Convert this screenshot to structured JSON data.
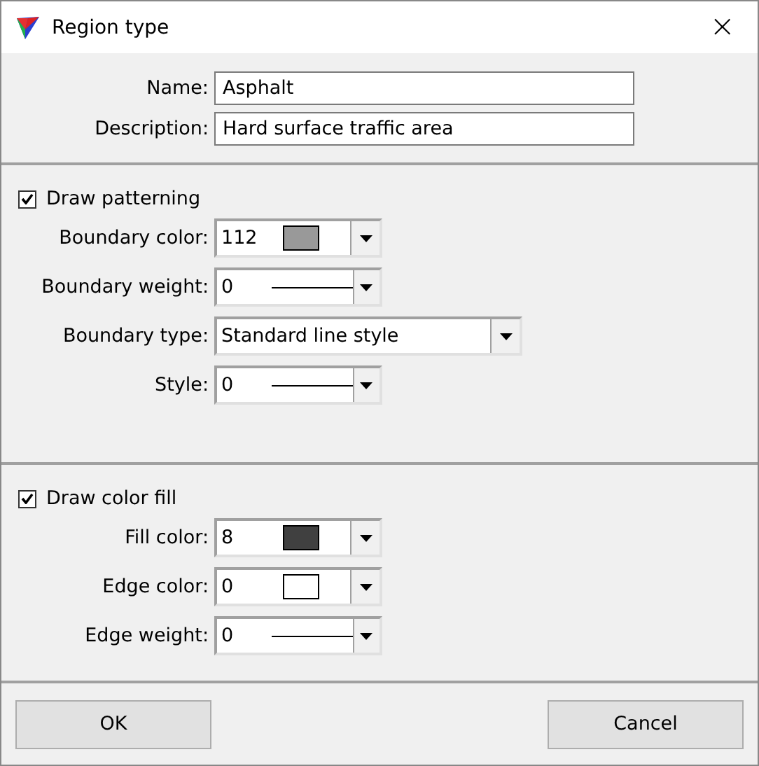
{
  "window": {
    "title": "Region type",
    "close": "×"
  },
  "identity": [
    {
      "label": "Name:",
      "value": "Asphalt"
    },
    {
      "label": "Description:",
      "value": "Hard surface traffic area"
    }
  ],
  "patterning": {
    "label": "Draw patterning",
    "checked": true,
    "fields": [
      {
        "label": "Boundary color:",
        "kind": "color",
        "value": "112",
        "color": "#999999"
      },
      {
        "label": "Boundary weight:",
        "kind": "line",
        "value": "0"
      },
      {
        "label": "Boundary type:",
        "kind": "text",
        "value": "Standard line style"
      },
      {
        "label": "Style:",
        "kind": "line",
        "value": "0"
      }
    ]
  },
  "fill": {
    "label": "Draw color fill",
    "checked": true,
    "fields": [
      {
        "label": "Fill color:",
        "kind": "color",
        "value": "8",
        "color": "#404040"
      },
      {
        "label": "Edge color:",
        "kind": "color",
        "value": "0",
        "color": "#ffffff"
      },
      {
        "label": "Edge weight:",
        "kind": "line",
        "value": "0"
      }
    ]
  },
  "buttons": [
    "OK",
    "Cancel"
  ]
}
